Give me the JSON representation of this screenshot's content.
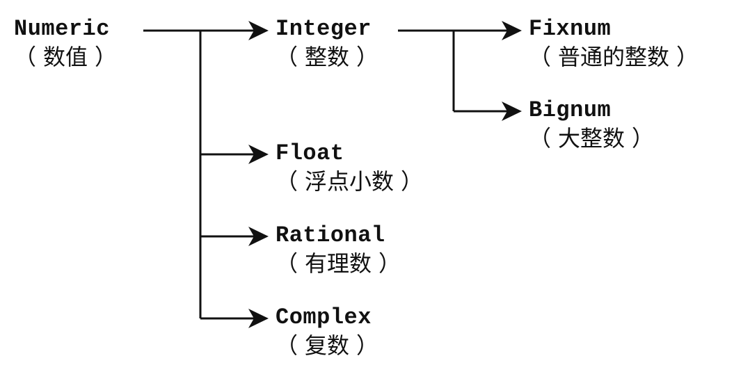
{
  "nodes": {
    "numeric": {
      "name": "Numeric",
      "label": "数值"
    },
    "integer": {
      "name": "Integer",
      "label": "整数"
    },
    "fixnum": {
      "name": "Fixnum",
      "label": "普通的整数"
    },
    "bignum": {
      "name": "Bignum",
      "label": "大整数"
    },
    "float": {
      "name": "Float",
      "label": "浮点小数"
    },
    "rational": {
      "name": "Rational",
      "label": "有理数"
    },
    "complex": {
      "name": "Complex",
      "label": "复数"
    }
  },
  "edges": [
    [
      "numeric",
      "integer"
    ],
    [
      "numeric",
      "float"
    ],
    [
      "numeric",
      "rational"
    ],
    [
      "numeric",
      "complex"
    ],
    [
      "integer",
      "fixnum"
    ],
    [
      "integer",
      "bignum"
    ]
  ],
  "paren_open": "（",
  "paren_close": "）"
}
